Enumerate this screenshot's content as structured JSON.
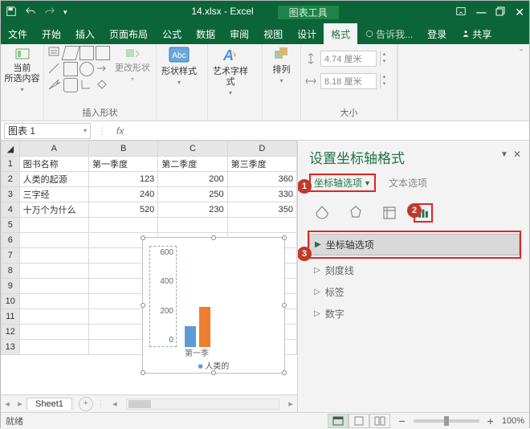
{
  "title": {
    "doc": "14.xlsx - Excel",
    "tool": "图表工具"
  },
  "tabs": [
    "文件",
    "开始",
    "插入",
    "页面布局",
    "公式",
    "数据",
    "审阅",
    "视图",
    "设计",
    "格式"
  ],
  "tell_me": "告诉我...",
  "login": "登录",
  "share": "共享",
  "ribbon": {
    "selection_label": "当前\n所选内容",
    "insert_shapes": "插入形状",
    "change_shape": "更改形状",
    "shape_styles": "形状样式",
    "wordart_styles": "艺术字样式",
    "arrange": "排列",
    "size": "大小",
    "height": "4.74 厘米",
    "width": "8.18 厘米"
  },
  "namebox": "图表 1",
  "sheet": {
    "cols": [
      "A",
      "B",
      "C",
      "D"
    ],
    "headers": [
      "图书名称",
      "第一季度",
      "第二季度",
      "第三季度"
    ],
    "rows": [
      [
        "人类的起源",
        "123",
        "200",
        "360"
      ],
      [
        "三字经",
        "240",
        "250",
        "330"
      ],
      [
        "十万个为什么",
        "520",
        "230",
        "350"
      ]
    ],
    "row_count": 13,
    "tab": "Sheet1"
  },
  "chart_data": {
    "type": "bar",
    "title": "",
    "categories": [
      "第一季度"
    ],
    "series": [
      {
        "name": "人类的起源",
        "values": [
          123
        ],
        "color": "#5b9bd5"
      },
      {
        "name": "三字经",
        "values": [
          240
        ],
        "color": "#ed7d31"
      }
    ],
    "ylim": [
      0,
      600
    ],
    "yticks": [
      "600",
      "400",
      "200",
      "0"
    ],
    "legend_prefix": "人类的",
    "category_partial": "第一季"
  },
  "pane": {
    "title": "设置坐标轴格式",
    "axis_options": "坐标轴选项",
    "text_options": "文本选项",
    "sections": {
      "axis_opts": "坐标轴选项",
      "ticks": "刻度线",
      "labels": "标签",
      "number": "数字"
    }
  },
  "status": {
    "ready": "就绪",
    "zoom": "100%"
  },
  "callouts": [
    "1",
    "2",
    "3"
  ]
}
